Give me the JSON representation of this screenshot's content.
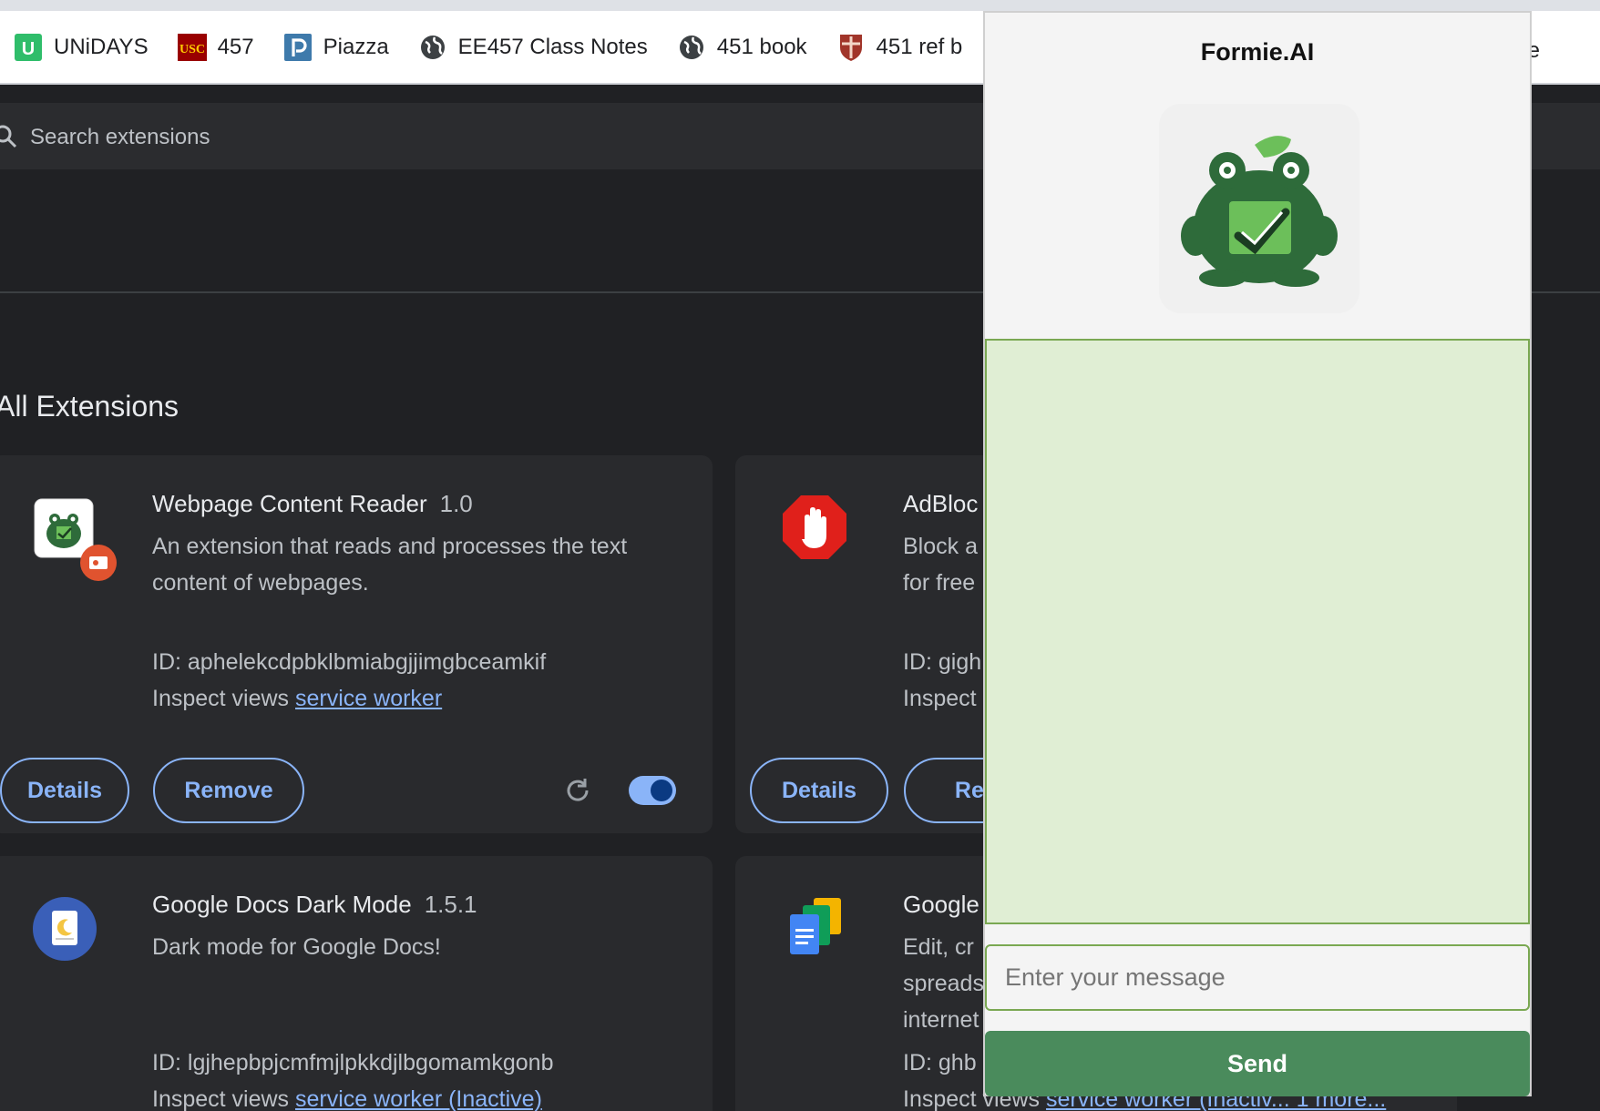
{
  "bookmarks": [
    {
      "label": "UNiDAYS",
      "icon": "unidays-icon"
    },
    {
      "label": "457",
      "icon": "usc-icon"
    },
    {
      "label": "Piazza",
      "icon": "piazza-icon"
    },
    {
      "label": "EE457 Class Notes",
      "icon": "globe-icon"
    },
    {
      "label": "451 book",
      "icon": "globe-icon"
    },
    {
      "label": "451 ref b",
      "icon": "shield-crest-icon"
    }
  ],
  "bookmark_tail": "te",
  "search": {
    "placeholder": "Search extensions"
  },
  "section_title": "All Extensions",
  "extensions": [
    {
      "name": "Webpage Content Reader",
      "version": "1.0",
      "description": "An extension that reads and processes the text content of webpages.",
      "id_line": "ID: aphelekcdpbklbmiabgjjimgbceamkif",
      "inspect_prefix": "Inspect views",
      "inspect_link": "service worker",
      "details_label": "Details",
      "remove_label": "Remove",
      "enabled": true
    },
    {
      "name": "AdBlock",
      "name_visible": "AdBloc",
      "desc_line1": "Block a",
      "desc_line2": "for free",
      "id_line": "ID: gigh",
      "inspect_prefix": "Inspect",
      "details_label": "Details",
      "remove_label": "Rem"
    },
    {
      "name": "Google Docs Dark Mode",
      "version": "1.5.1",
      "description": "Dark mode for Google Docs!",
      "id_line": "ID: lgjhepbpjcmfmjlpkkdjlbgomamkgonb",
      "inspect_prefix": "Inspect views",
      "inspect_link": "service worker (Inactive)"
    },
    {
      "name_visible": "Google",
      "desc_line1": "Edit, cr",
      "desc_line2": "spreads",
      "desc_line3": "internet",
      "id_line": "ID: ghb",
      "inspect_prefix": "Inspect views",
      "inspect_link": "service worker (Inactiv... 1 more..."
    }
  ],
  "popup": {
    "title": "Formie.AI",
    "input_placeholder": "Enter your message",
    "send_label": "Send"
  },
  "colors": {
    "accent_blue": "#8ab4f8",
    "chat_bg": "#e0eed4",
    "chat_border": "#7aa852",
    "send_bg": "#4a8b5c",
    "page_bg": "#202124",
    "card_bg": "#292a2d"
  }
}
